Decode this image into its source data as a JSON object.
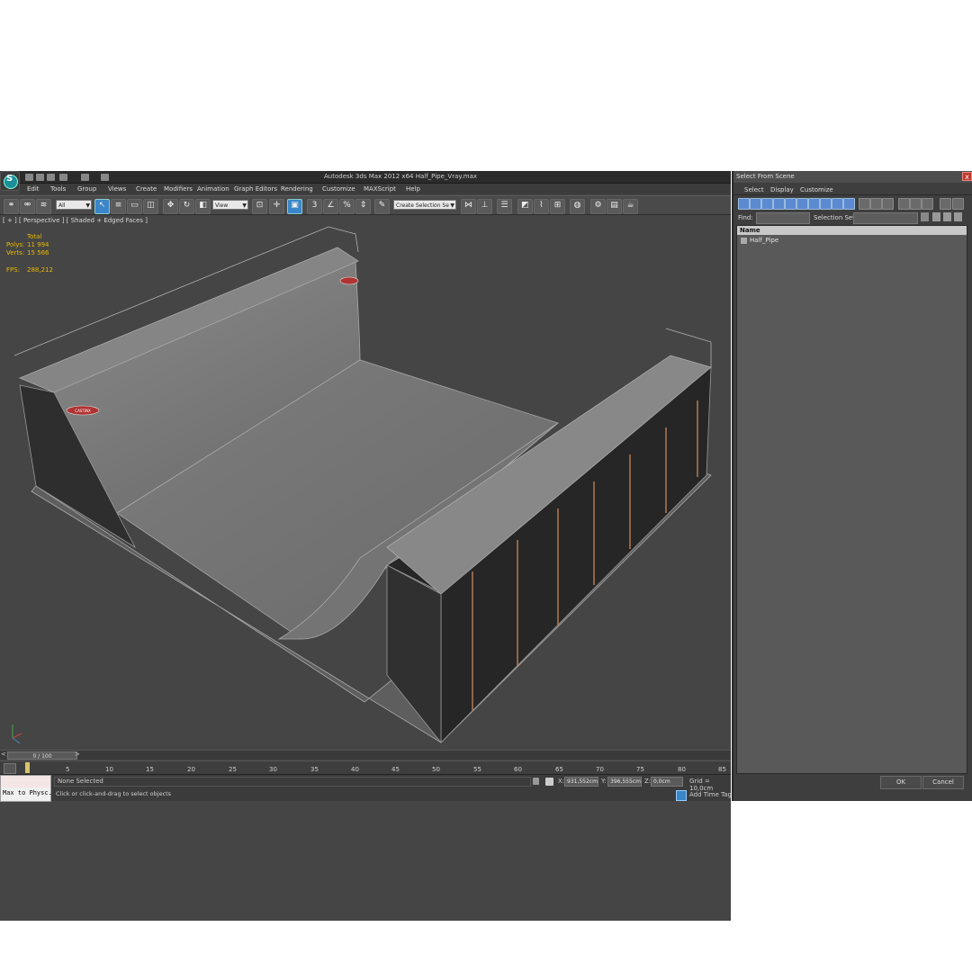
{
  "window": {
    "title": "Autodesk 3ds Max  2012 x64     Half_Pipe_Vray.max",
    "logo_letter": "S"
  },
  "menu": [
    "Edit",
    "Tools",
    "Group",
    "Views",
    "Create",
    "Modifiers",
    "Animation",
    "Graph Editors",
    "Rendering",
    "Customize",
    "MAXScript",
    "Help"
  ],
  "toolbar": {
    "filter_value": "All",
    "coord_system": "View",
    "selection_set_placeholder": "Create Selection Se"
  },
  "viewport": {
    "label": "[ + ] [ Perspective ] [ Shaded + Edged Faces ]",
    "stats": {
      "total_label": "Total",
      "polys_label": "Polys:",
      "polys_value": "11 994",
      "verts_label": "Verts:",
      "verts_value": "15 566",
      "fps_label": "FPS:",
      "fps_value": "288,212"
    },
    "model_name": "Half_Pipe",
    "decal_text": "CASTINX"
  },
  "timeline": {
    "slider_text": "0 / 100",
    "prev_arrow": "<",
    "next_arrow": ">",
    "ruler_ticks": [
      "5",
      "10",
      "15",
      "20",
      "25",
      "30",
      "35",
      "40",
      "45",
      "50",
      "55",
      "60",
      "65",
      "70",
      "75",
      "80",
      "85"
    ]
  },
  "status": {
    "maxscript_label": "Max to Physc.",
    "selection_text": "None Selected",
    "prompt_text": "Click or click-and-drag to select objects",
    "x_label": "X:",
    "x_value": "931,552cm",
    "y_label": "Y:",
    "y_value": "396,555cm",
    "z_label": "Z:",
    "z_value": "0,0cm",
    "grid_text": "Grid = 10,0cm",
    "add_time_tag": "Add Time Tag"
  },
  "panel": {
    "title": "Select From Scene",
    "close_glyph": "x",
    "tabs": [
      "Select",
      "Display",
      "Customize"
    ],
    "find_label": "Find:",
    "selection_sets_label": "Selection Set:",
    "column_header": "Name",
    "items": [
      "Half_Pipe"
    ],
    "ok_label": "OK",
    "cancel_label": "Cancel"
  },
  "colors": {
    "background": "#444444",
    "accent": "#3a86c8",
    "stats_yellow": "#e9b800",
    "wire": "#a0a0a0",
    "steel": "#b27a55"
  }
}
